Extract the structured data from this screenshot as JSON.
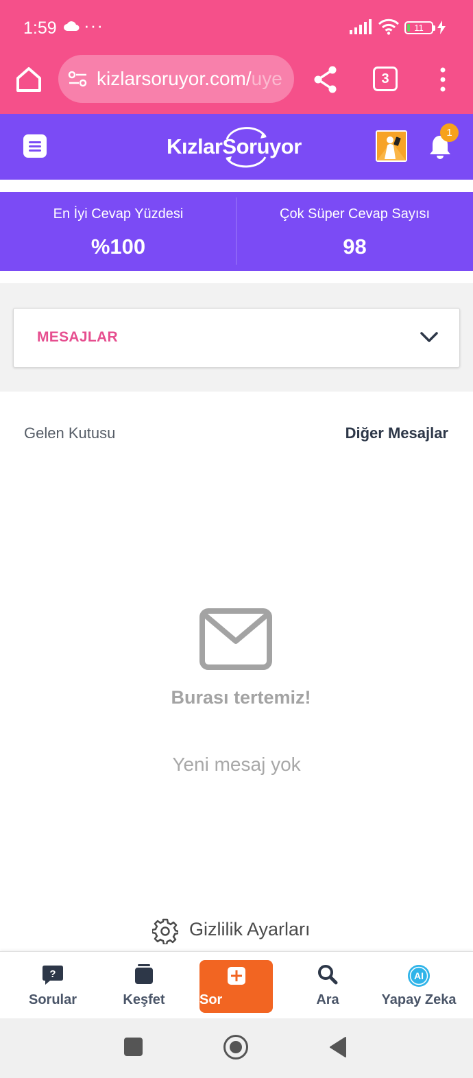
{
  "status_bar": {
    "time": "1:59",
    "dots": "···",
    "battery": "11"
  },
  "browser": {
    "url_visible": "kizlarsoruyor.com/",
    "url_faded": "uye",
    "tab_count": "3"
  },
  "header": {
    "logo_text": "KızlarSoruyor",
    "notification_count": "1"
  },
  "stats": {
    "left_label": "En İyi Cevap Yüzdesi",
    "left_value": "%100",
    "right_label": "Çok Süper Cevap Sayısı",
    "right_value": "98"
  },
  "messages_dropdown": {
    "label": "MESAJLAR"
  },
  "message_tabs": {
    "inbox": "Gelen Kutusu",
    "other": "Diğer Mesajlar"
  },
  "empty_state": {
    "title": "Burası tertemiz!",
    "subtitle": "Yeni mesaj yok"
  },
  "privacy": {
    "label": "Gizlilik Ayarları"
  },
  "bottom_nav": {
    "items": [
      {
        "label": "Sorular"
      },
      {
        "label": "Keşfet"
      },
      {
        "label": "Sor"
      },
      {
        "label": "Ara"
      },
      {
        "label": "Yapay Zeka"
      }
    ]
  },
  "colors": {
    "browser_pink": "#f5508a",
    "brand_purple": "#7b4bf5",
    "accent_pink": "#e64e8f",
    "ask_orange": "#f26522",
    "badge_orange": "#f7a21b"
  }
}
